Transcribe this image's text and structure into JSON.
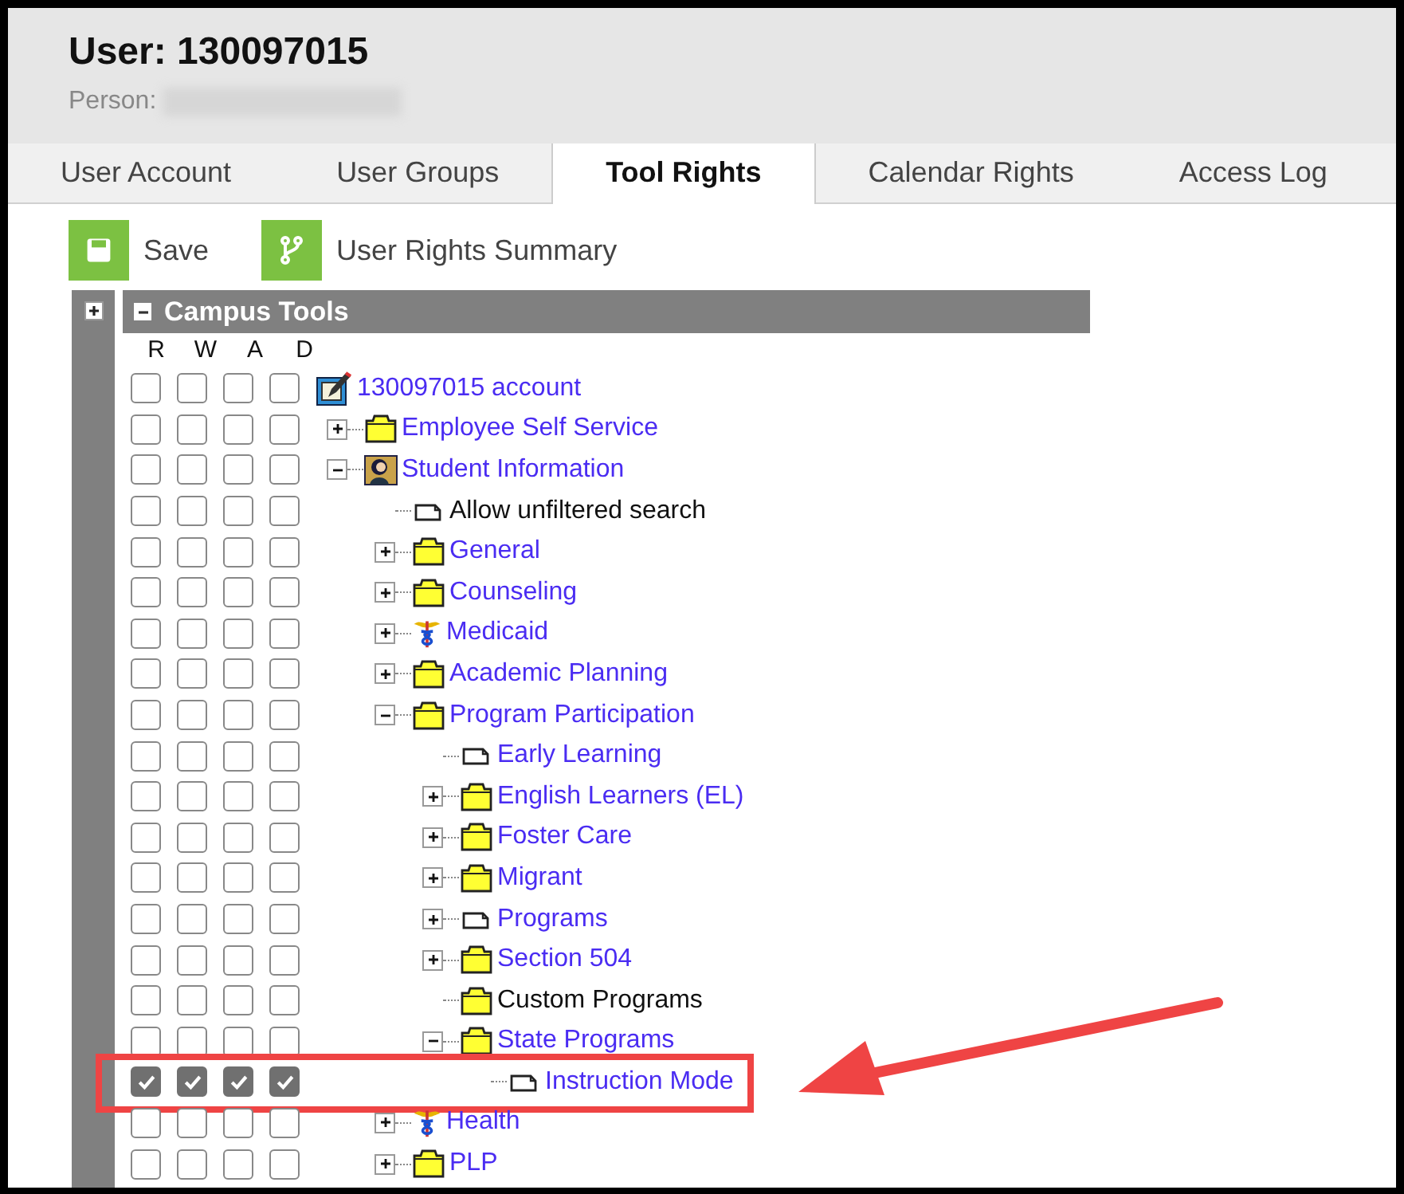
{
  "header": {
    "title": "User: 130097015",
    "person_label": "Person:"
  },
  "tabs": [
    {
      "label": "User Account",
      "selected": false
    },
    {
      "label": "User Groups",
      "selected": false
    },
    {
      "label": "Tool Rights",
      "selected": true
    },
    {
      "label": "Calendar Rights",
      "selected": false
    },
    {
      "label": "Access Log",
      "selected": false
    }
  ],
  "toolbar": [
    {
      "label": "Save",
      "kind": "save"
    },
    {
      "label": "User Rights Summary",
      "kind": "summary"
    }
  ],
  "rights_panel": {
    "title": "Campus Tools",
    "columns": [
      "R",
      "W",
      "A",
      "D"
    ],
    "tree": [
      {
        "label": "130097015 account",
        "kind": "account",
        "link": true,
        "highlighted": false,
        "checked": [
          false,
          false,
          false,
          false
        ],
        "children": [
          {
            "label": "Employee Self Service",
            "kind": "folder",
            "link": true,
            "expanded": false,
            "highlighted": false,
            "checked": [
              false,
              false,
              false,
              false
            ]
          },
          {
            "label": "Student Information",
            "kind": "person",
            "link": true,
            "expanded": true,
            "highlighted": false,
            "checked": [
              false,
              false,
              false,
              false
            ],
            "children": [
              {
                "label": "Allow unfiltered search",
                "kind": "page",
                "link": false,
                "highlighted": false,
                "checked": [
                  false,
                  false,
                  false,
                  false
                ]
              },
              {
                "label": "General",
                "kind": "folder",
                "link": true,
                "expanded": false,
                "highlighted": false,
                "checked": [
                  false,
                  false,
                  false,
                  false
                ]
              },
              {
                "label": "Counseling",
                "kind": "folder",
                "link": true,
                "expanded": false,
                "highlighted": false,
                "checked": [
                  false,
                  false,
                  false,
                  false
                ]
              },
              {
                "label": "Medicaid",
                "kind": "medical",
                "link": true,
                "expanded": false,
                "highlighted": false,
                "checked": [
                  false,
                  false,
                  false,
                  false
                ]
              },
              {
                "label": "Academic Planning",
                "kind": "folder",
                "link": true,
                "expanded": false,
                "highlighted": false,
                "checked": [
                  false,
                  false,
                  false,
                  false
                ]
              },
              {
                "label": "Program Participation",
                "kind": "folder",
                "link": true,
                "expanded": true,
                "highlighted": false,
                "checked": [
                  false,
                  false,
                  false,
                  false
                ],
                "children": [
                  {
                    "label": "Early Learning",
                    "kind": "page",
                    "link": true,
                    "highlighted": false,
                    "checked": [
                      false,
                      false,
                      false,
                      false
                    ]
                  },
                  {
                    "label": "English Learners (EL)",
                    "kind": "folder",
                    "link": true,
                    "expanded": false,
                    "highlighted": false,
                    "checked": [
                      false,
                      false,
                      false,
                      false
                    ]
                  },
                  {
                    "label": "Foster Care",
                    "kind": "folder",
                    "link": true,
                    "expanded": false,
                    "highlighted": false,
                    "checked": [
                      false,
                      false,
                      false,
                      false
                    ]
                  },
                  {
                    "label": "Migrant",
                    "kind": "folder",
                    "link": true,
                    "expanded": false,
                    "highlighted": false,
                    "checked": [
                      false,
                      false,
                      false,
                      false
                    ]
                  },
                  {
                    "label": "Programs",
                    "kind": "page",
                    "link": true,
                    "expanded": false,
                    "highlighted": false,
                    "checked": [
                      false,
                      false,
                      false,
                      false
                    ]
                  },
                  {
                    "label": "Section 504",
                    "kind": "folder",
                    "link": true,
                    "expanded": false,
                    "highlighted": false,
                    "checked": [
                      false,
                      false,
                      false,
                      false
                    ]
                  },
                  {
                    "label": "Custom Programs",
                    "kind": "folder",
                    "link": false,
                    "highlighted": false,
                    "checked": [
                      false,
                      false,
                      false,
                      false
                    ]
                  },
                  {
                    "label": "State Programs",
                    "kind": "folder",
                    "link": true,
                    "expanded": true,
                    "highlighted": false,
                    "checked": [
                      false,
                      false,
                      false,
                      false
                    ],
                    "children": [
                      {
                        "label": "Instruction Mode",
                        "kind": "page",
                        "link": true,
                        "highlighted": true,
                        "checked": [
                          true,
                          true,
                          true,
                          true
                        ]
                      }
                    ]
                  }
                ]
              },
              {
                "label": "Health",
                "kind": "medical",
                "link": true,
                "expanded": false,
                "highlighted": false,
                "checked": [
                  false,
                  false,
                  false,
                  false
                ]
              },
              {
                "label": "PLP",
                "kind": "folder",
                "link": true,
                "expanded": false,
                "highlighted": false,
                "checked": [
                  false,
                  false,
                  false,
                  false
                ]
              }
            ]
          }
        ]
      }
    ]
  }
}
